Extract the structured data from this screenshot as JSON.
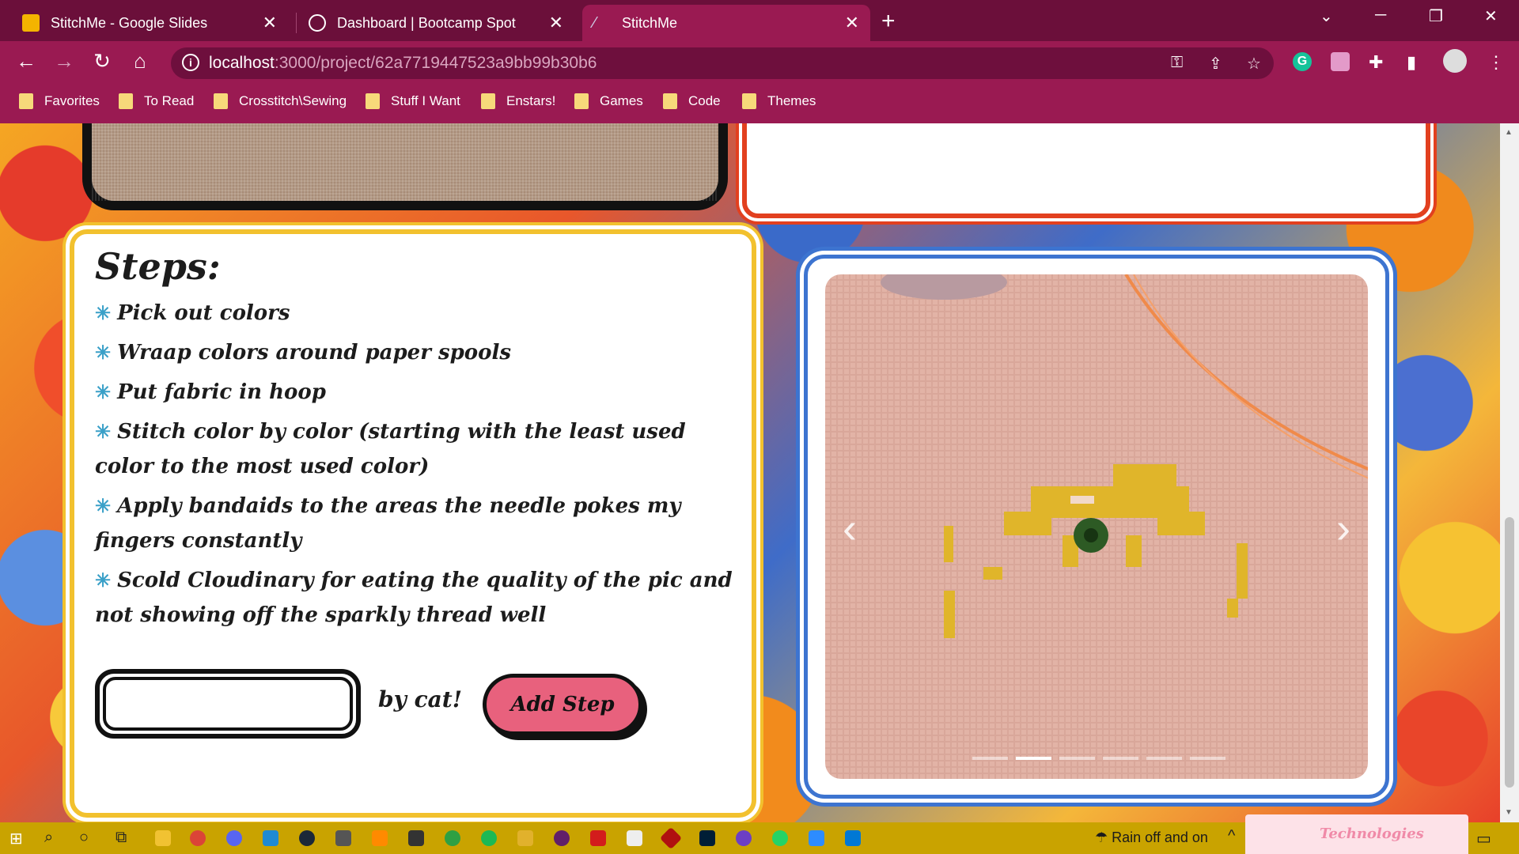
{
  "browser": {
    "tabs": [
      {
        "title": "StitchMe - Google Slides",
        "icon": "slides-icon"
      },
      {
        "title": "Dashboard | Bootcamp Spot",
        "icon": "globe-icon"
      },
      {
        "title": "StitchMe",
        "icon": "needle-icon",
        "active": true
      }
    ],
    "url_host": "localhost",
    "url_path": ":3000/project/62a7719447523a9bb99b30b6",
    "bookmarks": [
      "Favorites",
      "To Read",
      "Crosstitch\\Sewing",
      "Stuff I Want",
      "Enstars!",
      "Games",
      "Code",
      "Themes"
    ]
  },
  "steps": {
    "title": "Steps:",
    "items": [
      "Pick out colors",
      "Wraap colors around paper spools",
      "Put fabric in hoop",
      "Stitch color by color (starting with the least used color to the most used color)",
      "Apply bandaids to the areas the needle pokes my fingers constantly",
      "Scold Cloudinary for eating the quality of the pic and not showing off the sparkly thread well"
    ],
    "input_value": "",
    "by_label": "by cat!",
    "add_button": "Add Step"
  },
  "carousel": {
    "slide_count": 6,
    "active_index": 1
  },
  "taskbar": {
    "weather": "Rain off and on",
    "widget_text": "Technologies"
  },
  "colors": {
    "browser_frame": "#6b0f3a",
    "toolbar": "#9a1a52",
    "steps_border": "#f2c12e",
    "image_border": "#3d74d0",
    "add_button": "#e8617d",
    "taskbar": "#c9a300"
  }
}
